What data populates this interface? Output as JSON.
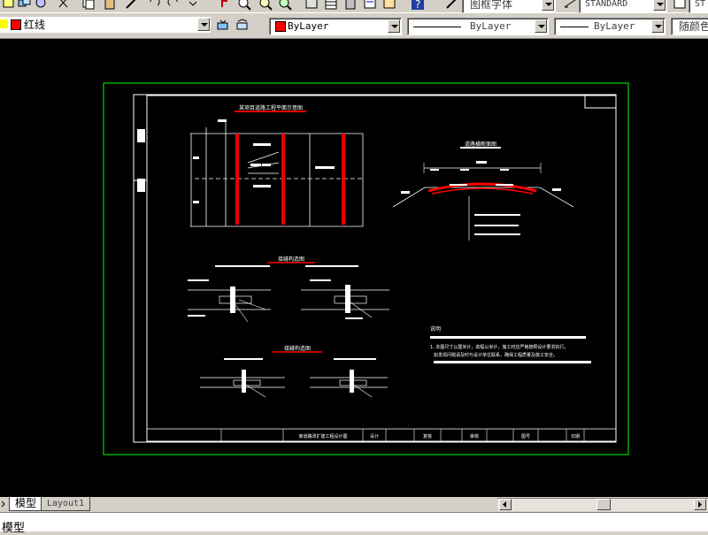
{
  "toolbar_top": {
    "text_style": "图框字体",
    "dim_style": "STANDARD",
    "partial": "ST"
  },
  "properties_bar": {
    "layer_name": "红线",
    "color_value": "ByLayer",
    "linetype_value": "ByLayer",
    "lineweight_value": "ByLayer",
    "plotstyle_value": "随颜色"
  },
  "drawing": {
    "plan_title": "某项目道路工程平面示意图",
    "section_title": "道路横断面图",
    "detail_title_1": "接缝构造图",
    "detail_title_2": "接缝构造图",
    "notes_title": "说明",
    "notes_line_1": "1. 本图尺寸以厘米计，高程以米计，施工时应严格按照设计要求执行，",
    "notes_line_2": "如发现问题请及时与设计单位联系，确保工程质量及施工安全。",
    "title_block": {
      "drawing_name": "某道路改扩建工程设计图",
      "design": "设计",
      "review": "复核",
      "approve": "审核",
      "drawing_no": "图号",
      "date": "日期"
    }
  },
  "tabs": {
    "model": "模型",
    "layout1": "Layout1"
  },
  "command_line": {
    "text": "模型"
  },
  "colors": {
    "background": "#000000",
    "outer_border": "#00ff00",
    "frame": "#ffffff",
    "accent_red": "#ff0000"
  }
}
